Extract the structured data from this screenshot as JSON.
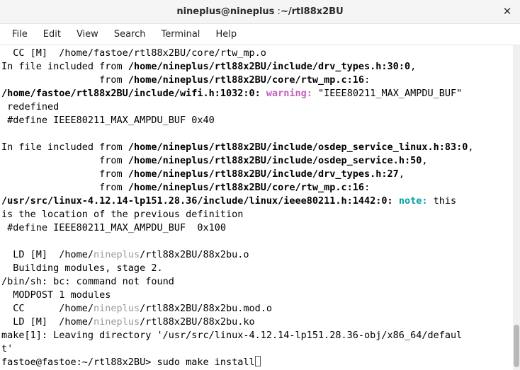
{
  "titlebar": {
    "user_host": "nineplus@nineplus",
    "sep": " :",
    "path": "~/rtl88x2BU"
  },
  "menu": {
    "file": "File",
    "edit": "Edit",
    "view": "View",
    "search": "Search",
    "terminal": "Terminal",
    "help": "Help"
  },
  "t": {
    "l1": "  CC [M]  /home/fastoe/rtl88x2BU/core/rtw_mp.o",
    "l2a": "In file included from ",
    "l2b": "/home/nineplus/rtl88x2BU/include/drv_types.h:30:0",
    "l2c": ",",
    "l3a": "                 from ",
    "l3b": "/home/nineplus/rtl88x2BU/core/rtw_mp.c:16",
    "l3c": ":",
    "l4a": "/home/fastoe/rtl88x2BU/include/wifi.h:1032:0:",
    "l4w": "warning:",
    "l4b": " \"IEEE80211_MAX_AMPDU_BUF\"",
    "l5": " redefined",
    "l6": " #define IEEE80211_MAX_AMPDU_BUF 0x40",
    "l7": "",
    "l8a": "In file included from ",
    "l8b": "/home/nineplus/rtl88x2BU/include/osdep_service_linux.h:83:0",
    "l8c": ",",
    "l9a": "                 from ",
    "l9b": "/home/nineplus/rtl88x2BU/include/osdep_service.h:50",
    "l9c": ",",
    "l10a": "                 from ",
    "l10b": "/home/nineplus/rtl88x2BU/include/drv_types.h:27",
    "l10c": ",",
    "l11a": "                 from ",
    "l11b": "/home/nineplus/rtl88x2BU/core/rtw_mp.c:16",
    "l11c": ":",
    "l12a": "/usr/src/linux-4.12.14-lp151.28.36/include/linux/ieee80211.h:1442:0:",
    "l12n": "note:",
    "l12b": " this",
    "l13": "is the location of the previous definition",
    "l14": " #define IEEE80211_MAX_AMPDU_BUF  0x100",
    "l15": "",
    "l16a": "  LD [M]  /home/",
    "l16u": "nineplus",
    "l16b": "/rtl88x2BU/88x2bu.o",
    "l17": "  Building modules, stage 2.",
    "l18": "/bin/sh: bc: command not found",
    "l19": "  MODPOST 1 modules",
    "l20a": "  CC      /home/",
    "l20u": "nineplus",
    "l20b": "/rtl88x2BU/88x2bu.mod.o",
    "l21a": "  LD [M]  /home/",
    "l21u": "nineplus",
    "l21b": "/rtl88x2BU/88x2bu.ko",
    "l22": "make[1]: Leaving directory '/usr/src/linux-4.12.14-lp151.28.36-obj/x86_64/defaul",
    "l23": "t'",
    "l24a": "fastoe@fastoe:~/rtl88x2BU> ",
    "l24b": "sudo make install"
  }
}
